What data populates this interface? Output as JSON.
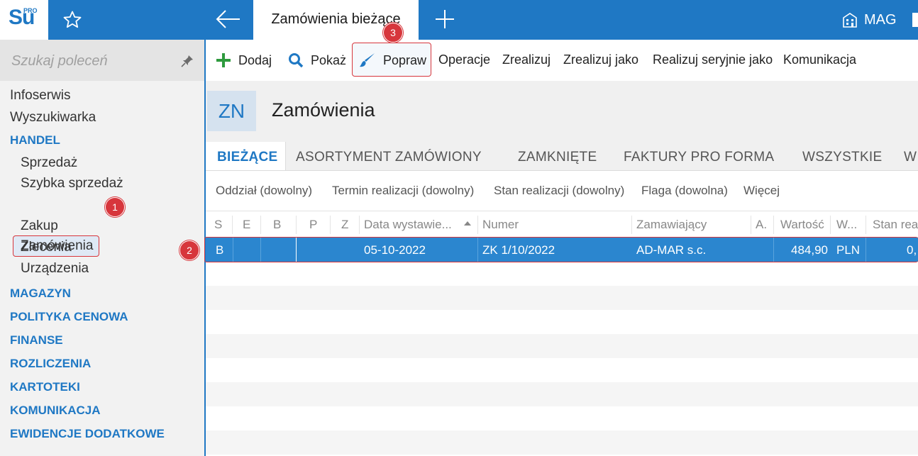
{
  "app": {
    "logo_text": "Su",
    "logo_sup": "PRO"
  },
  "topbar": {
    "active_tab": "Zamówienia bieżące",
    "warehouse": "MAG"
  },
  "sidebar": {
    "search_placeholder": "Szukaj poleceń",
    "items": [
      {
        "label": "Infoserwis"
      },
      {
        "label": "Wyszukiwarka"
      }
    ],
    "handel": {
      "label": "HANDEL",
      "sub": [
        "Sprzedaż",
        "Szybka sprzedaż",
        "Zamówienia",
        "Zakup",
        "Zlecenia",
        "Urządzenia"
      ]
    },
    "sections": [
      "MAGAZYN",
      "POLITYKA CENOWA",
      "FINANSE",
      "ROZLICZENIA",
      "KARTOTEKI",
      "KOMUNIKACJA",
      "EWIDENCJE DODATKOWE"
    ]
  },
  "toolbar": {
    "dodaj": "Dodaj",
    "pokaz": "Pokaż",
    "popraw": "Popraw",
    "operacje": "Operacje",
    "zrealizuj": "Zrealizuj",
    "zrealizuj_jako": "Zrealizuj jako",
    "realizuj_seryjnie": "Realizuj seryjnie jako",
    "komunikacja": "Komunikacja"
  },
  "module": {
    "code": "ZN",
    "title": "Zamówienia"
  },
  "tabs": [
    "BIEŻĄCE",
    "ASORTYMENT ZAMÓWIONY",
    "ZAMKNIĘTE",
    "FAKTURY PRO FORMA",
    "WSZYSTKIE",
    "W"
  ],
  "filters": [
    "Oddział (dowolny)",
    "Termin realizacji (dowolny)",
    "Stan realizacji (dowolny)",
    "Flaga (dowolna)",
    "Więcej"
  ],
  "grid": {
    "columns": [
      "S",
      "E",
      "B",
      "P",
      "Z",
      "Data wystawie...",
      "Numer",
      "Zamawiający",
      "A.",
      "Wartość",
      "W...",
      "Stan rea"
    ],
    "rows": [
      {
        "s": "B",
        "e": "",
        "b": "",
        "p": "",
        "z": "",
        "data": "05-10-2022",
        "numer": "ZK 1/10/2022",
        "zamawiajacy": "AD-MAR s.c.",
        "a": "",
        "wartosc": "484,90",
        "waluta": "PLN",
        "stan": "0,"
      }
    ]
  },
  "badges": {
    "one": "1",
    "two": "2",
    "three": "3"
  },
  "colors": {
    "accent": "#1f78c4",
    "selected_row": "#2b86cf",
    "highlight": "#d7363c",
    "add_icon": "#2e9a3e"
  }
}
